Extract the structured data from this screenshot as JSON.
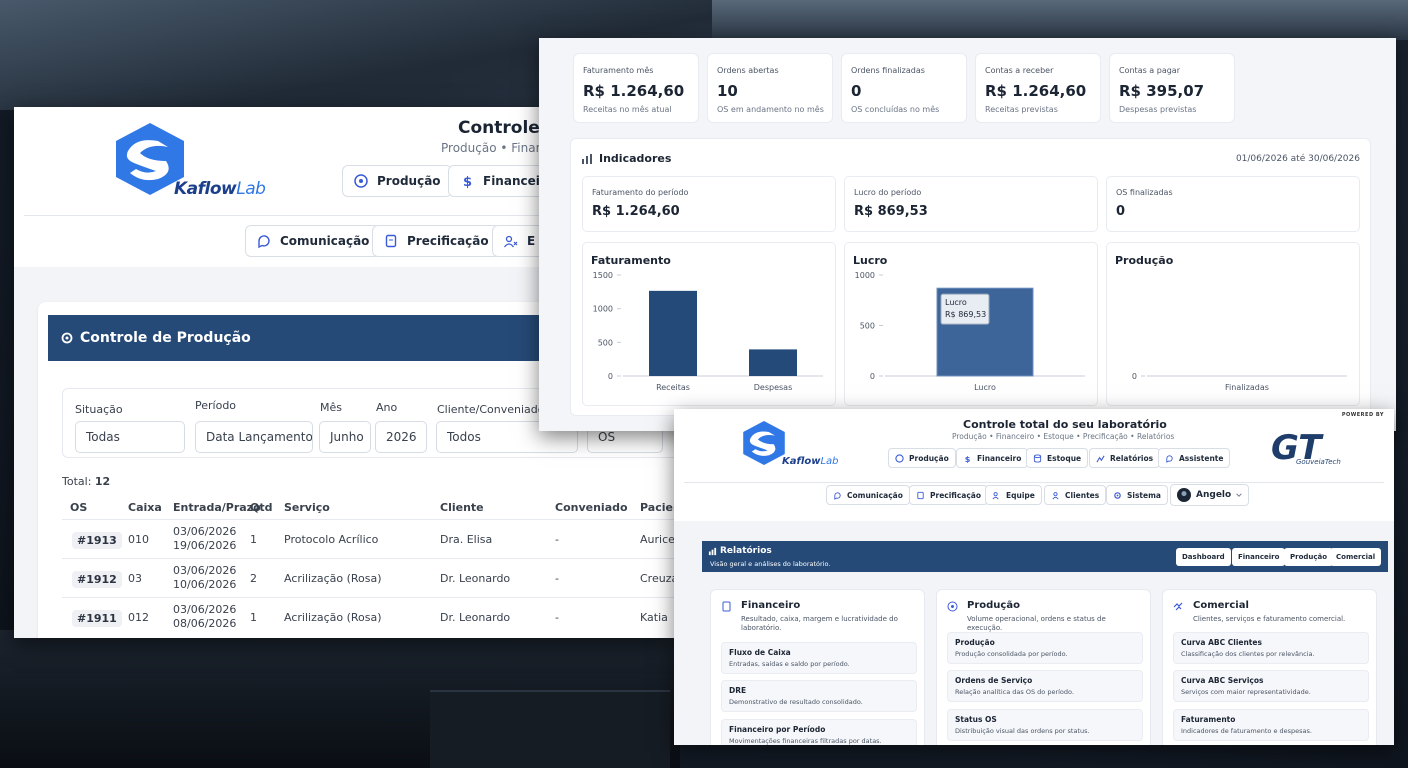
{
  "production": {
    "brand_main": "Kaflow",
    "brand_accent": "Lab",
    "title": "Controle",
    "subtitle": "Produção • Financ",
    "nav_row1": [
      "Produção",
      "Financeiro"
    ],
    "nav_row2": [
      "Comunicação",
      "Precificação",
      "E"
    ],
    "section_title": "Controle de Produção",
    "filters": {
      "situacao_label": "Situação",
      "situacao_value": "Todas",
      "periodo_label": "Período",
      "periodo_value": "Data Lançamento",
      "mes_label": "Mês",
      "mes_value": "Junho",
      "ano_label": "Ano",
      "ano_value": "2026",
      "cliente_label": "Cliente/Conveniado",
      "cliente_value": "Todos",
      "os_value": "OS"
    },
    "total_label": "Total:",
    "total_value": "12",
    "columns": [
      "OS",
      "Caixa",
      "Entrada/Prazo",
      "Qtd",
      "Serviço",
      "Cliente",
      "Conveniado",
      "Pacien"
    ],
    "rows": [
      {
        "os": "#1913",
        "caixa": "010",
        "entrada": "03/06/2026",
        "prazo": "19/06/2026",
        "qtd": "1",
        "servico": "Protocolo Acrílico",
        "cliente": "Dra. Elisa",
        "conveniado": "-",
        "paciente": "Aurice"
      },
      {
        "os": "#1912",
        "caixa": "03",
        "entrada": "03/06/2026",
        "prazo": "10/06/2026",
        "qtd": "2",
        "servico": "Acrilização (Rosa)",
        "cliente": "Dr. Leonardo",
        "conveniado": "-",
        "paciente": "Creuza"
      },
      {
        "os": "#1911",
        "caixa": "012",
        "entrada": "03/06/2026",
        "prazo": "08/06/2026",
        "qtd": "1",
        "servico": "Acrilização (Rosa)",
        "cliente": "Dr. Leonardo",
        "conveniado": "-",
        "paciente": "Katia"
      }
    ]
  },
  "dashboard": {
    "kpis": [
      {
        "label": "Faturamento mês",
        "value": "R$ 1.264,60",
        "sub": "Receitas no mês atual"
      },
      {
        "label": "Ordens abertas",
        "value": "10",
        "sub": "OS em andamento no mês"
      },
      {
        "label": "Ordens finalizadas",
        "value": "0",
        "sub": "OS concluídas no mês"
      },
      {
        "label": "Contas a receber",
        "value": "R$ 1.264,60",
        "sub": "Receitas previstas"
      },
      {
        "label": "Contas a pagar",
        "value": "R$ 395,07",
        "sub": "Despesas previstas"
      }
    ],
    "indicators_title": "Indicadores",
    "range": "01/06/2026 até 30/06/2026",
    "subkpis": [
      {
        "label": "Faturamento do período",
        "value": "R$ 1.264,60"
      },
      {
        "label": "Lucro do período",
        "value": "R$ 869,53"
      },
      {
        "label": "OS finalizadas",
        "value": "0"
      }
    ],
    "tooltip_label": "Lucro",
    "tooltip_value": "R$ 869,53"
  },
  "chart_data": [
    {
      "type": "bar",
      "title": "Faturamento",
      "categories": [
        "Receitas",
        "Despesas"
      ],
      "values": [
        1264.6,
        395.07
      ],
      "ylim": [
        0,
        1500
      ],
      "yticks": [
        "0",
        "500",
        "1000",
        "1500"
      ]
    },
    {
      "type": "bar",
      "title": "Lucro",
      "categories": [
        "Lucro"
      ],
      "values": [
        869.53
      ],
      "ylim": [
        0,
        1000
      ],
      "yticks": [
        "0",
        "500",
        "1000"
      ]
    },
    {
      "type": "bar",
      "title": "Produção",
      "categories": [
        "Finalizadas"
      ],
      "values": [
        0
      ],
      "ylim": [
        0,
        1
      ],
      "yticks": [
        "0"
      ]
    }
  ],
  "reports": {
    "powered_by": "POWERED BY",
    "title": "Controle total do seu laboratório",
    "subtitle": "Produção • Financeiro • Estoque • Precificação • Relatórios",
    "brand_main": "Kaflow",
    "brand_accent": "Lab",
    "gt_brand": "GouveiaTech",
    "nav_row1": [
      "Produção",
      "Financeiro",
      "Estoque",
      "Relatórios",
      "Assistente"
    ],
    "nav_row2": [
      "Comunicação",
      "Precificação",
      "Equipe",
      "Clientes",
      "Sistema"
    ],
    "user_name": "Angelo",
    "section_title": "Relatórios",
    "section_sub": "Visão geral e análises do laboratório.",
    "tabs": [
      "Dashboard",
      "Financeiro",
      "Produção",
      "Comercial"
    ],
    "cards": [
      {
        "title": "Financeiro",
        "desc": "Resultado, caixa, margem e lucratividade do laboratório.",
        "items": [
          {
            "name": "Fluxo de Caixa",
            "desc": "Entradas, saídas e saldo por período."
          },
          {
            "name": "DRE",
            "desc": "Demonstrativo de resultado consolidado."
          },
          {
            "name": "Financeiro por Período",
            "desc": "Movimentações financeiras filtradas por datas."
          }
        ]
      },
      {
        "title": "Produção",
        "desc": "Volume operacional, ordens e status de execução.",
        "items": [
          {
            "name": "Produção",
            "desc": "Produção consolidada por período."
          },
          {
            "name": "Ordens de Serviço",
            "desc": "Relação analítica das OS do período."
          },
          {
            "name": "Status OS",
            "desc": "Distribuição visual das ordens por status."
          }
        ]
      },
      {
        "title": "Comercial",
        "desc": "Clientes, serviços e faturamento comercial.",
        "items": [
          {
            "name": "Curva ABC Clientes",
            "desc": "Classificação dos clientes por relevância."
          },
          {
            "name": "Curva ABC Serviços",
            "desc": "Serviços com maior representatividade."
          },
          {
            "name": "Faturamento",
            "desc": "Indicadores de faturamento e despesas."
          }
        ]
      }
    ]
  },
  "colors": {
    "primary": "#264a77",
    "bar": "#244a7a",
    "accent": "#2f78e6"
  }
}
